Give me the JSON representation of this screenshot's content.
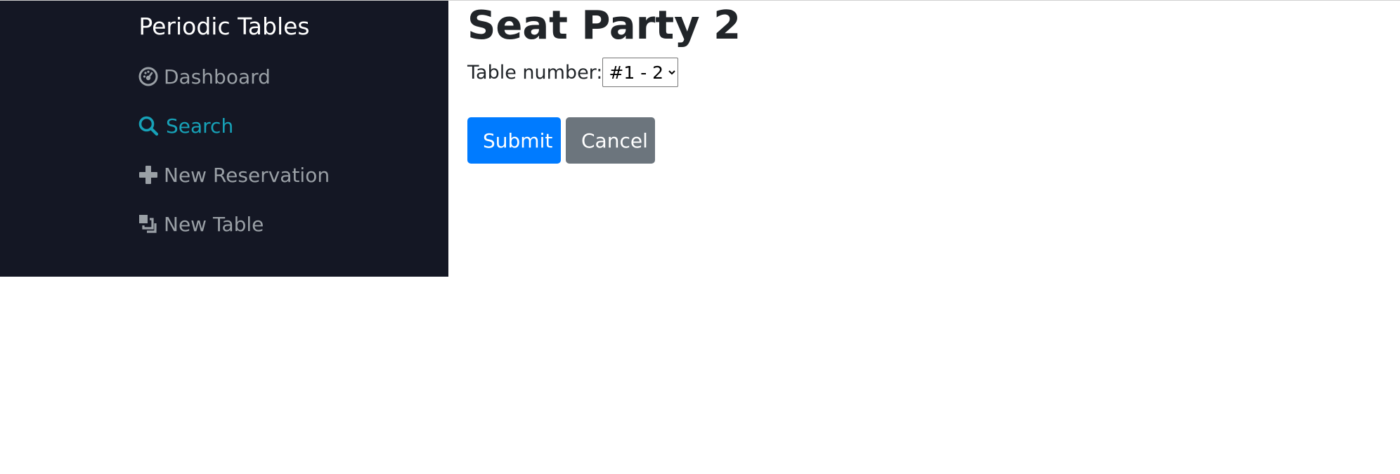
{
  "sidebar": {
    "brand": "Periodic Tables",
    "items": [
      {
        "label": "Dashboard",
        "icon": "dashboard-gauge-icon",
        "active": false
      },
      {
        "label": "Search",
        "icon": "search-icon",
        "active": true
      },
      {
        "label": "New Reservation",
        "icon": "plus-icon",
        "active": false
      },
      {
        "label": "New Table",
        "icon": "layers-icon",
        "active": false
      }
    ],
    "colors": {
      "background": "#141724",
      "text": "#9aa0a6",
      "active": "#17a2b8",
      "brand": "#ffffff"
    }
  },
  "main": {
    "title": "Seat Party 2",
    "table_label": "Table number:",
    "table_selected": "#1 - 2",
    "submit_label": "Submit",
    "cancel_label": "Cancel"
  },
  "colors": {
    "primary": "#007bff",
    "secondary": "#6c757d"
  }
}
